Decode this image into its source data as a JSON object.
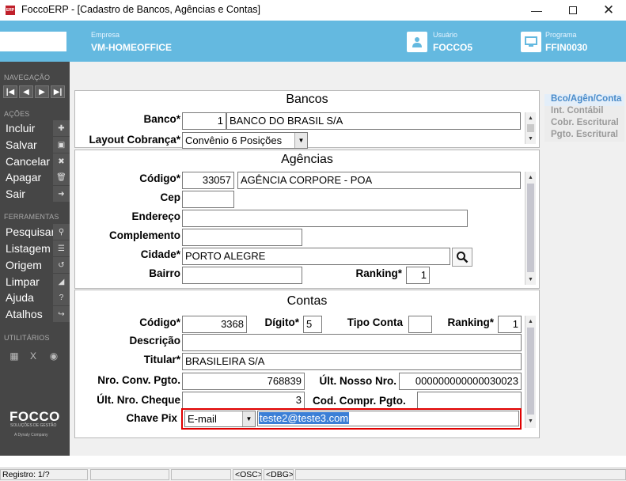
{
  "window": {
    "title": "FoccoERP - [Cadastro de Bancos, Agências e Contas]",
    "logo_text": "ERP"
  },
  "header": {
    "empresa_label": "Empresa",
    "empresa_value": "VM-HOMEOFFICE",
    "usuario_label": "Usuário",
    "usuario_value": "FOCCO5",
    "programa_label": "Programa",
    "programa_value": "FFIN0030",
    "accent_color": "#64b9e0"
  },
  "sidebar": {
    "nav_section": "NAVEGAÇÃO",
    "nav_buttons": [
      "|◀",
      "◀",
      "▶",
      "▶|"
    ],
    "actions_section": "AÇÕES",
    "actions": [
      {
        "label": "Incluir",
        "icon": "plus-icon",
        "glyph": "✚"
      },
      {
        "label": "Salvar",
        "icon": "save-icon",
        "glyph": "▣"
      },
      {
        "label": "Cancelar",
        "icon": "cancel-icon",
        "glyph": "✖"
      },
      {
        "label": "Apagar",
        "icon": "trash-icon",
        "glyph": "🗑"
      },
      {
        "label": "Sair",
        "icon": "exit-icon",
        "glyph": "➜"
      }
    ],
    "tools_section": "FERRAMENTAS",
    "tools": [
      {
        "label": "Pesquisar",
        "icon": "search-icon",
        "glyph": "⚲"
      },
      {
        "label": "Listagem",
        "icon": "list-icon",
        "glyph": "☰"
      },
      {
        "label": "Origem",
        "icon": "history-icon",
        "glyph": "↺"
      },
      {
        "label": "Limpar",
        "icon": "eraser-icon",
        "glyph": "◢"
      },
      {
        "label": "Ajuda",
        "icon": "help-icon",
        "glyph": "?"
      },
      {
        "label": "Atalhos",
        "icon": "shortcut-icon",
        "glyph": "↪"
      }
    ],
    "utils_section": "UTILITÁRIOS",
    "brand": "FOCCO",
    "brand_sub": "SOLUÇÕES DE GESTÃO",
    "brand_sub2": "A Dynaly Company"
  },
  "bancos": {
    "title": "Bancos",
    "banco_label": "Banco*",
    "banco_code": "1",
    "banco_name": "BANCO DO BRASIL S/A",
    "layout_label": "Layout Cobrança*",
    "layout_value": "Convênio 6 Posições"
  },
  "agencias": {
    "title": "Agências",
    "codigo_label": "Código*",
    "codigo_value": "33057",
    "agencia_name": "AGÊNCIA CORPORE - POA",
    "cep_label": "Cep",
    "cep_value": "",
    "endereco_label": "Endereço",
    "endereco_value": "",
    "complemento_label": "Complemento",
    "complemento_value": "",
    "cidade_label": "Cidade*",
    "cidade_value": "PORTO ALEGRE",
    "bairro_label": "Bairro",
    "bairro_value": "",
    "ranking_label": "Ranking*",
    "ranking_value": "1"
  },
  "contas": {
    "title": "Contas",
    "codigo_label": "Código*",
    "codigo_value": "3368",
    "digito_label": "Dígito*",
    "digito_value": "5",
    "tipo_label": "Tipo Conta",
    "tipo_value": "",
    "ranking_label": "Ranking*",
    "ranking_value": "1",
    "descricao_label": "Descrição",
    "descricao_value": "",
    "titular_label": "Titular*",
    "titular_value": "BRASILEIRA S/A",
    "conv_label": "Nro. Conv. Pgto.",
    "conv_value": "768839",
    "nosso_label": "Últ. Nosso Nro.",
    "nosso_value": "000000000000030023",
    "cheque_label": "Últ. Nro. Cheque",
    "cheque_value": "3",
    "compr_label": "Cod. Compr. Pgto.",
    "compr_value": "",
    "pix_label": "Chave Pix",
    "pix_type": "E-mail",
    "pix_value": "teste2@teste3.com",
    "highlight_color": "#e00000"
  },
  "right_tabs": [
    "Bco/Agên/Conta",
    "Int. Contábil",
    "Cobr. Escritural",
    "Pgto. Escritural"
  ],
  "statusbar": {
    "registro": "Registro: 1/?",
    "osc": "<OSC>",
    "dbg": "<DBG>"
  }
}
